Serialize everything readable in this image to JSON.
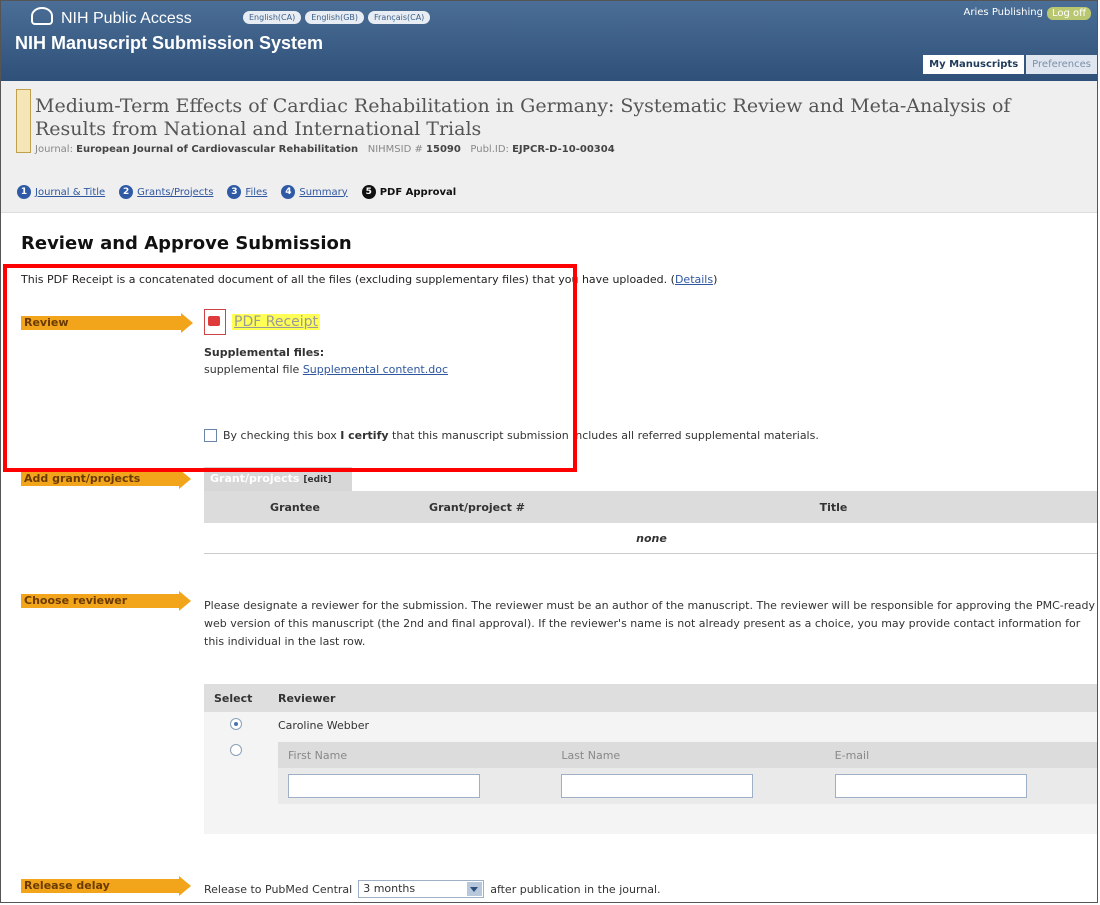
{
  "app": {
    "brand": "NIH Public Access",
    "system_title": "NIH Manuscript Submission System",
    "languages": [
      "English(CA)",
      "English(GB)",
      "Français(CA)"
    ],
    "user": "Aries Publishing",
    "logoff": "Log off",
    "tabs": [
      "My Manuscripts",
      "Preferences"
    ]
  },
  "manuscript": {
    "title": "Medium-Term Effects of Cardiac Rehabilitation in Germany: Systematic Review and Meta-Analysis of Results from National and International Trials",
    "journal_label": "Journal:",
    "journal": "European Journal of Cardiovascular Rehabilitation",
    "nihmsid_label": "NIHMSID #",
    "nihmsid": "15090",
    "publid_label": "Publ.ID:",
    "publid": "EJPCR-D-10-00304"
  },
  "steps": [
    {
      "num": "1",
      "label": "Journal & Title"
    },
    {
      "num": "2",
      "label": "Grants/Projects"
    },
    {
      "num": "3",
      "label": "Files"
    },
    {
      "num": "4",
      "label": "Summary"
    },
    {
      "num": "5",
      "label": "PDF Approval"
    }
  ],
  "page": {
    "heading": "Review and Approve Submission",
    "intro": "This PDF Receipt is a concatenated document of all the files (excluding supplementary files) that you have uploaded.",
    "intro_open": "(",
    "details": "Details",
    "intro_close": ")"
  },
  "review": {
    "label": "Review",
    "pdf_link": "PDF Receipt",
    "supp_label": "Supplemental files:",
    "supp_prefix": "supplemental file",
    "supp_link": "Supplemental content.doc",
    "certify_pre": "By checking this box",
    "certify_bold": "I certify",
    "certify_post": "that this manuscript submission includes all referred supplemental materials."
  },
  "grants": {
    "label": "Add grant/projects",
    "tab": "Grant/projects",
    "tab_edit": "[edit]",
    "columns": [
      "Grantee",
      "Grant/project #",
      "Title"
    ],
    "empty": "none"
  },
  "reviewer": {
    "label": "Choose reviewer",
    "text": "Please designate a reviewer for the submission. The reviewer must be an author of the manuscript. The reviewer will be responsible for approving the PMC-ready web version of this manuscript (the 2nd and final approval). If the reviewer's name is not already present as a choice, you may provide contact information for this individual in the last row.",
    "col_select": "Select",
    "col_reviewer": "Reviewer",
    "existing": "Caroline Webber",
    "new_fields": [
      "First Name",
      "Last Name",
      "E-mail"
    ]
  },
  "release": {
    "label": "Release delay",
    "prefix": "Release to PubMed Central",
    "value": "3 months",
    "suffix": "after publication in the journal."
  }
}
